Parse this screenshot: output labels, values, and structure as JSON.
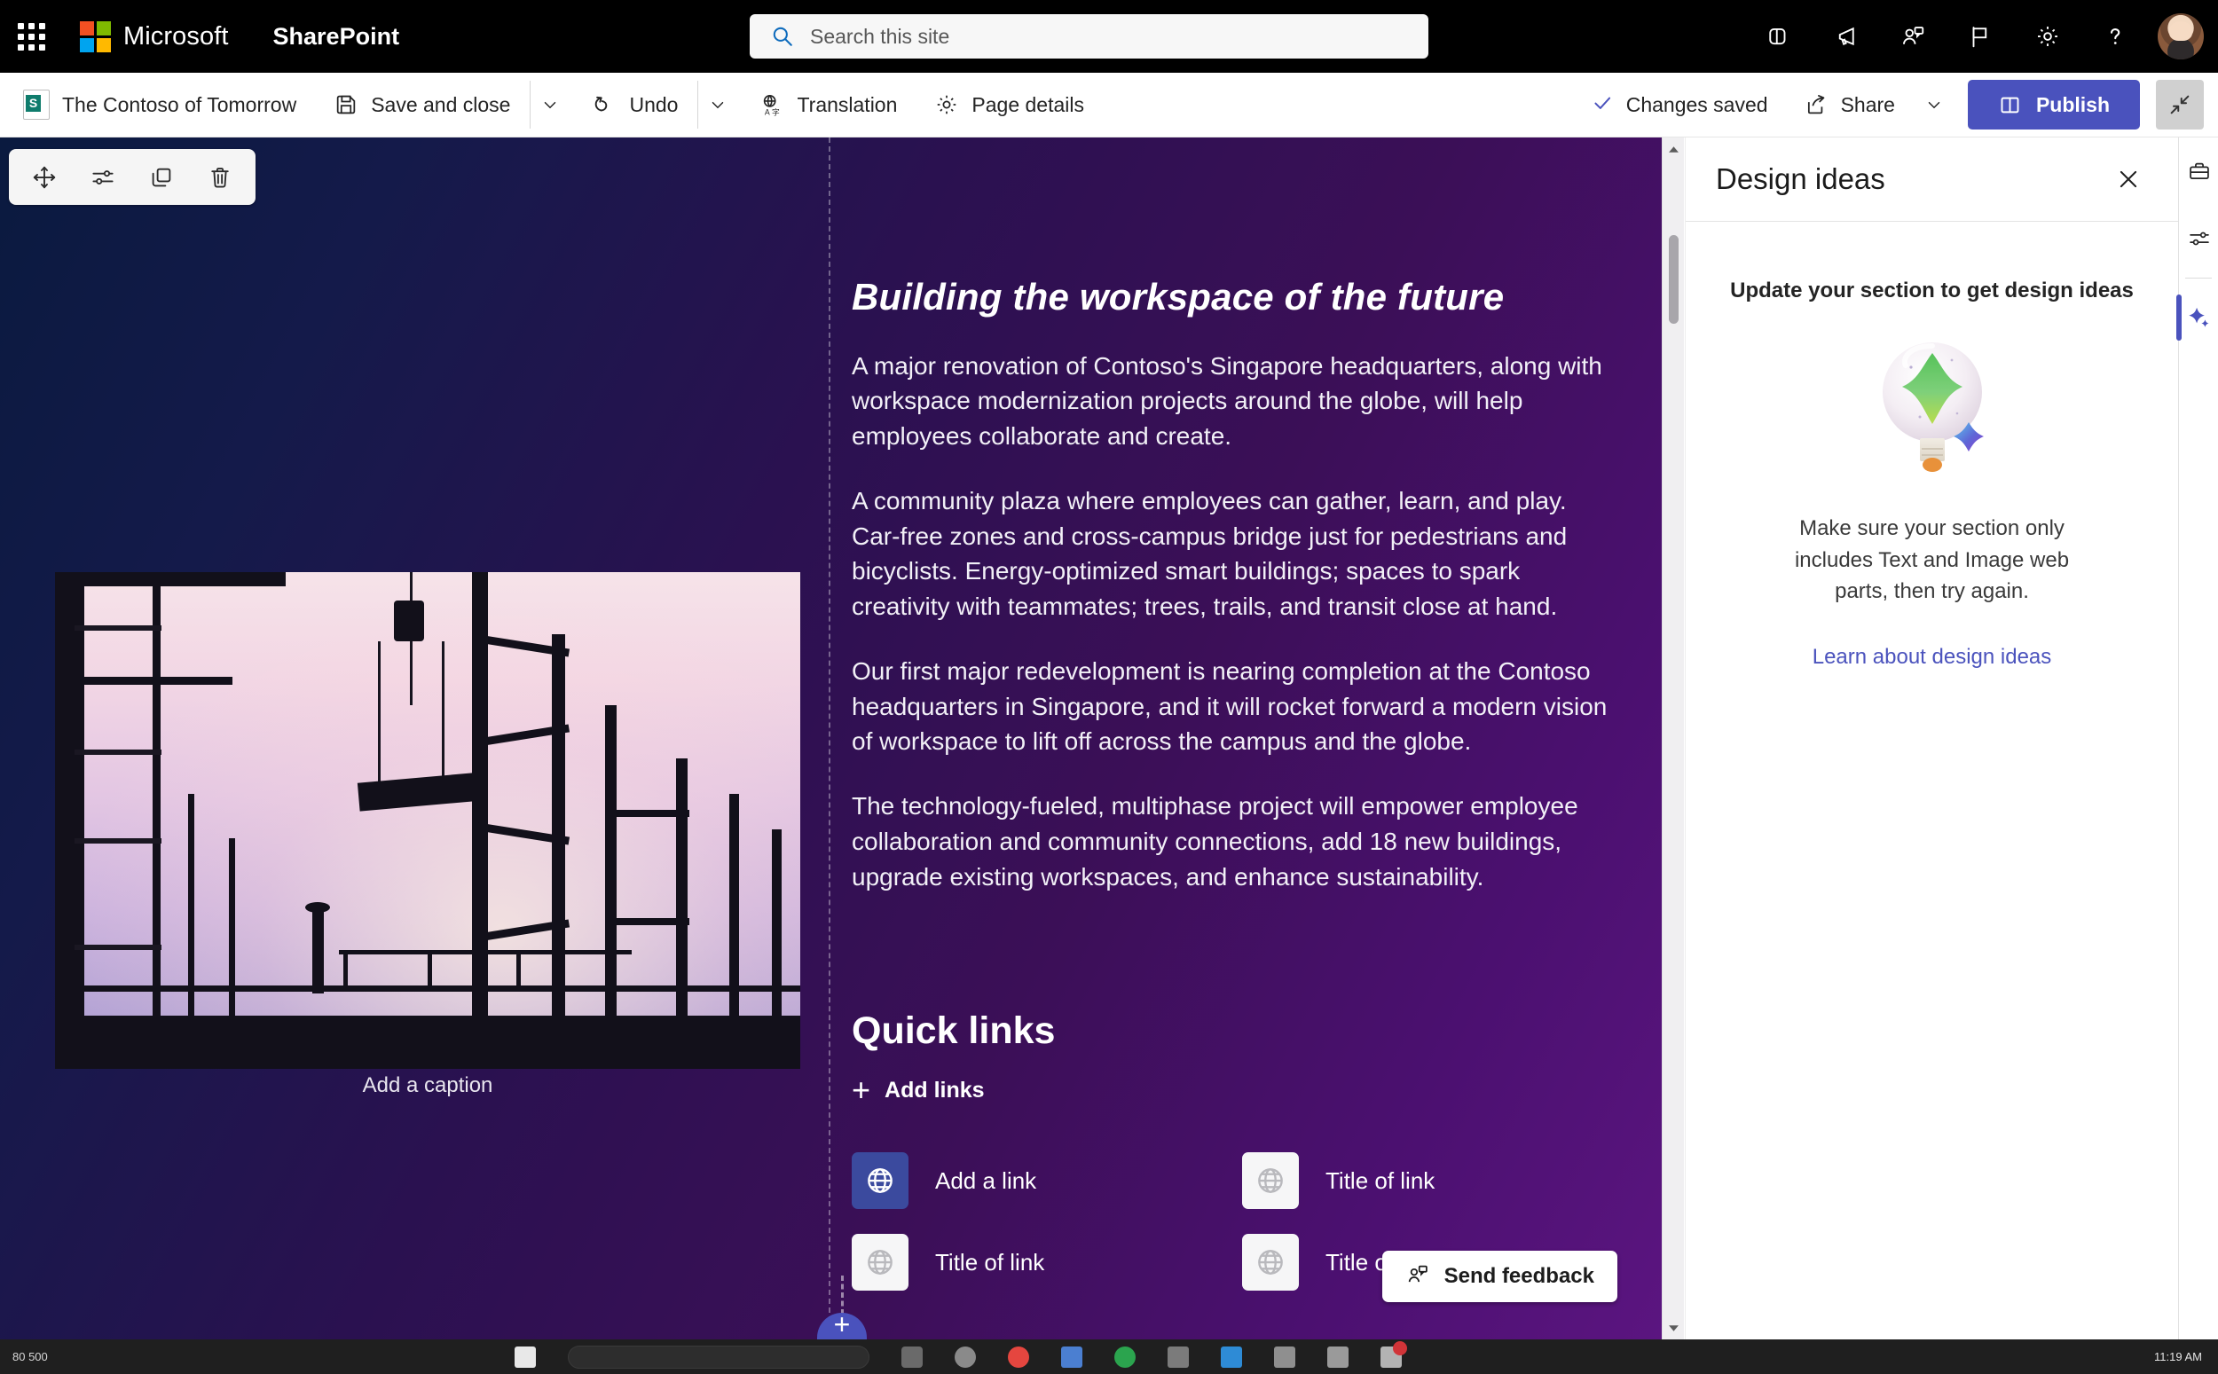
{
  "suite": {
    "waffle_label": "app-launcher",
    "brand": "Microsoft",
    "app": "SharePoint",
    "search": {
      "placeholder": "Search this site",
      "value": "",
      "icon": "search-icon"
    },
    "actions": [
      {
        "name": "copilot-icon",
        "label": "Copilot"
      },
      {
        "name": "megaphone-icon",
        "label": "Announcements"
      },
      {
        "name": "people-chat-icon",
        "label": "Chat"
      },
      {
        "name": "flag-icon",
        "label": "Flag"
      },
      {
        "name": "gear-icon",
        "label": "Settings"
      },
      {
        "name": "help-icon",
        "label": "Help"
      }
    ],
    "avatar_label": "Account manager"
  },
  "commandbar": {
    "page_title": "The Contoso of Tomorrow",
    "save_and_close": "Save and close",
    "undo": "Undo",
    "translation": "Translation",
    "page_details": "Page details",
    "changes_saved": "Changes saved",
    "share": "Share",
    "publish": "Publish",
    "collapse_label": "Collapse ribbon",
    "icons": {
      "page": "sharepoint-page-icon",
      "save": "save-disk-icon",
      "undo": "undo-arrow-icon",
      "translation": "translation-icon",
      "details": "gear-icon",
      "saved_check": "checkmark-icon",
      "share": "share-icon",
      "publish": "book-icon",
      "collapse": "collapse-diagonal-icon",
      "chevron": "chevron-down-icon"
    }
  },
  "webpart_toolbar": {
    "move": "move-handle-icon",
    "edit": "edit-properties-icon",
    "duplicate": "duplicate-icon",
    "delete": "trash-icon"
  },
  "canvas": {
    "image": {
      "caption_placeholder": "Add a caption",
      "alt": "construction-site-at-dusk"
    },
    "text": {
      "heading": "Building the workspace of the future",
      "paragraphs": [
        "A major renovation of Contoso's Singapore headquarters, along with workspace modernization projects around the globe, will help employees collaborate and create.",
        "A community plaza where employees can gather, learn, and play. Car-free zones and cross-campus bridge just for pedestrians and bicyclists. Energy-optimized smart buildings; spaces to spark creativity with teammates; trees, trails, and transit close at hand.",
        "Our first major redevelopment is nearing completion at the Contoso headquarters in Singapore, and it will rocket forward a modern vision of workspace to lift off across the campus and the globe.",
        "The technology-fueled, multiphase project will empower employee collaboration and community connections, add 18 new buildings, upgrade existing workspaces, and enhance sustainability."
      ]
    },
    "quick_links": {
      "title": "Quick links",
      "add_links": "Add links",
      "items": [
        {
          "label": "Add a link",
          "state": "active",
          "icon": "globe-icon"
        },
        {
          "label": "Title of link",
          "state": "plain",
          "icon": "globe-icon"
        },
        {
          "label": "Title of link",
          "state": "plain",
          "icon": "globe-icon"
        },
        {
          "label": "Title of link",
          "state": "plain",
          "icon": "globe-icon"
        }
      ]
    },
    "add_section_label": "+",
    "feedback": {
      "label": "Send feedback",
      "icon": "feedback-person-icon"
    }
  },
  "design_pane": {
    "title": "Design ideas",
    "close_label": "Close",
    "subheading": "Update your section to get design ideas",
    "illustration": "lightbulb-sparkle-illustration",
    "message": "Make sure your section only includes Text and Image web parts, then try again.",
    "link": "Learn about design ideas"
  },
  "rail": {
    "items": [
      {
        "name": "toolbox-icon",
        "label": "Toolbox",
        "active": false
      },
      {
        "name": "sliders-icon",
        "label": "Properties",
        "active": false
      },
      {
        "name": "sparkle-icon",
        "label": "Design ideas",
        "active": true
      }
    ]
  },
  "taskbar": {
    "zoom": "80 500",
    "clock": "11:19 AM",
    "date": ""
  },
  "colors": {
    "accent": "#4a52bd",
    "link": "#4b53bd",
    "suite_bg": "#000000",
    "canvas_start": "#0a1a3f",
    "canvas_end": "#5b1580"
  }
}
